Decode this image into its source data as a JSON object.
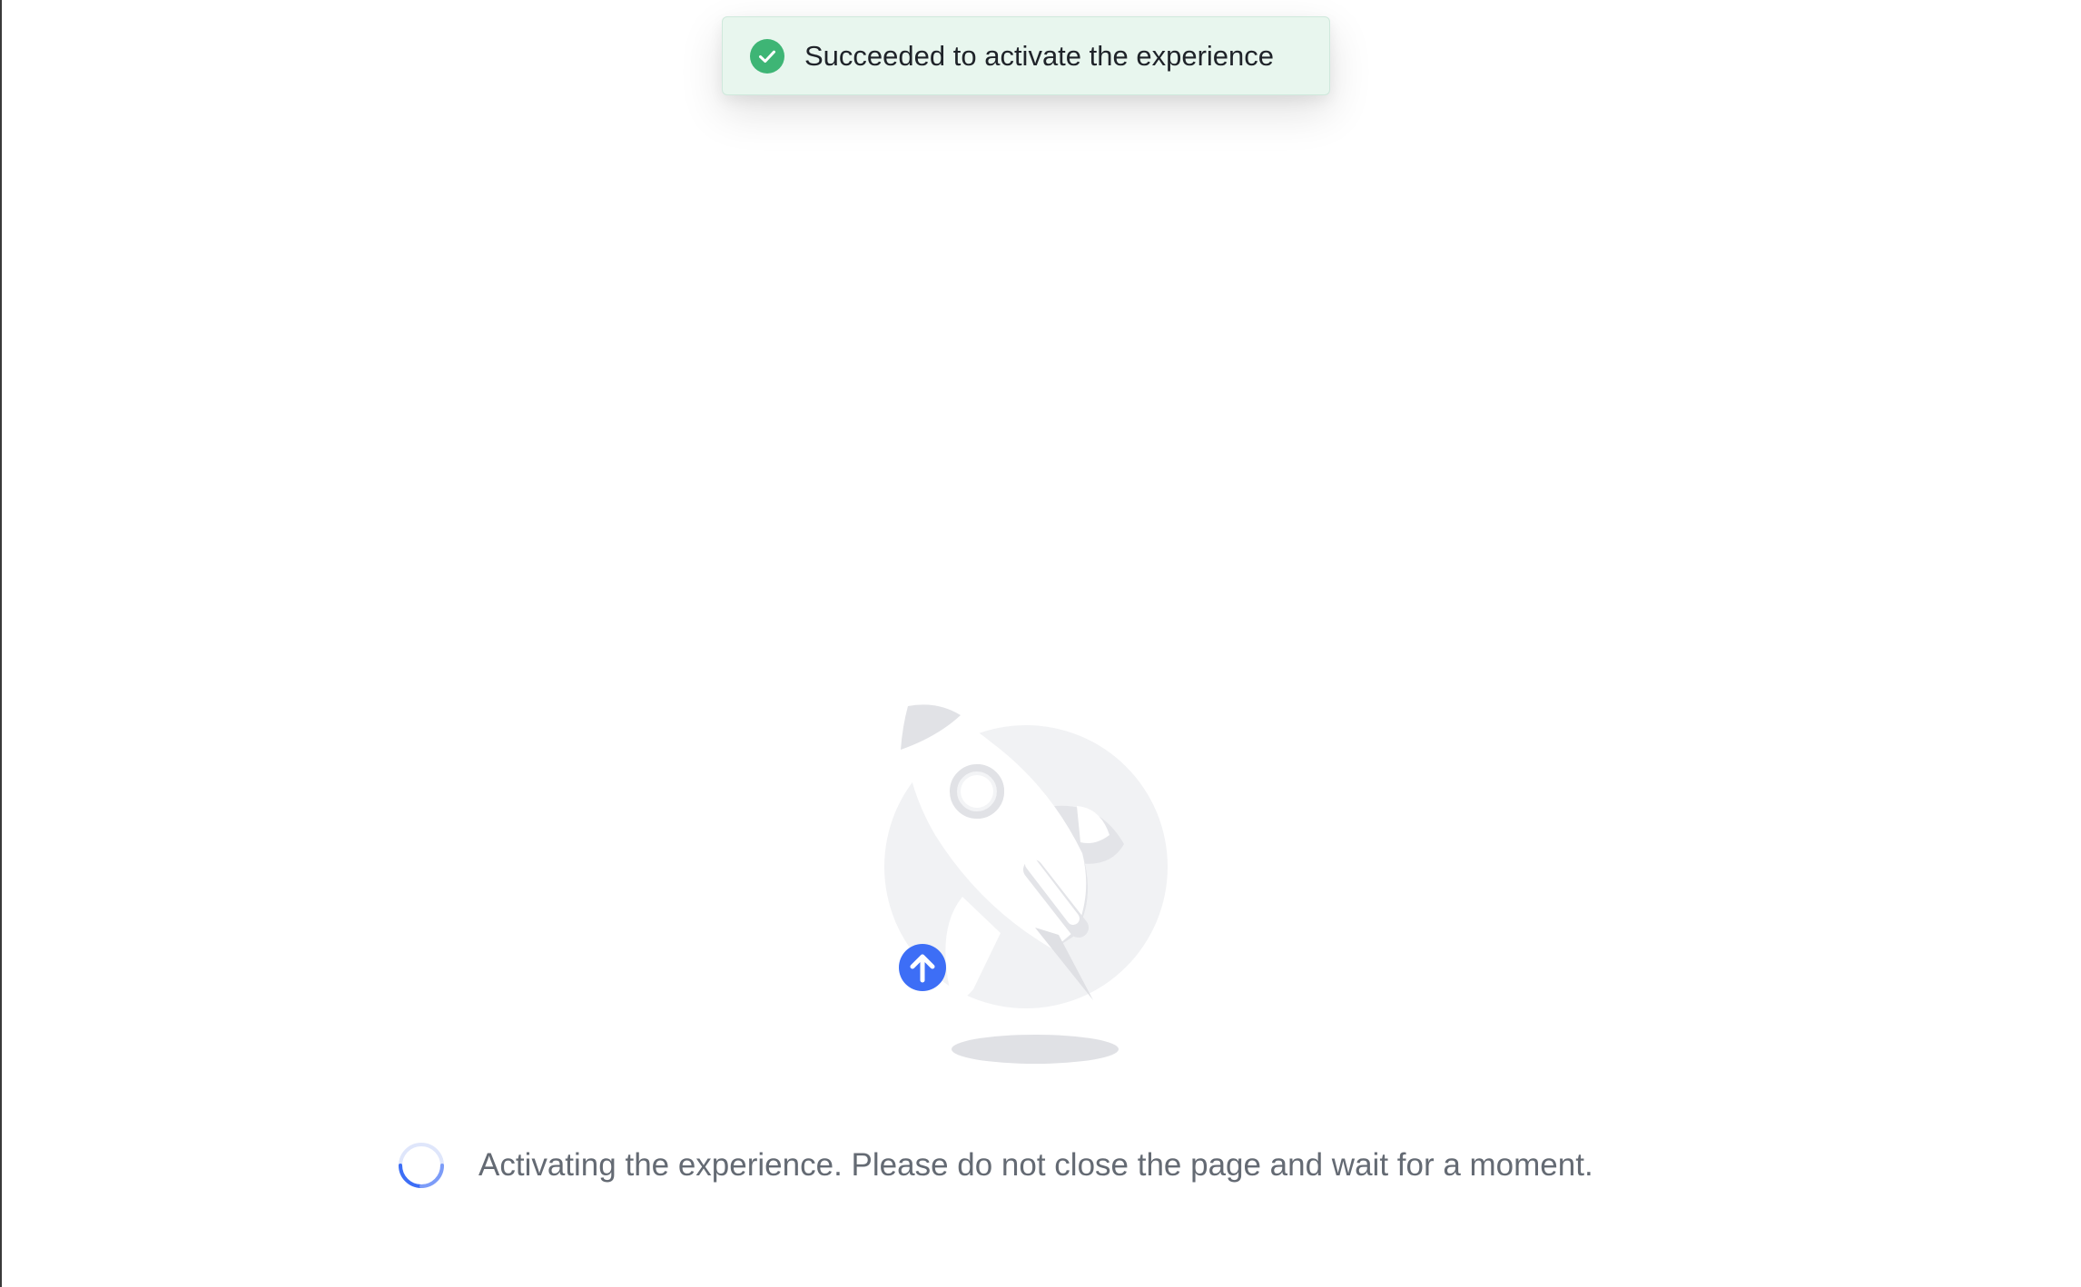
{
  "toast": {
    "message": "Succeeded to activate the experience",
    "icon": "check-circle-icon",
    "status_color": "#3eb575"
  },
  "illustration": {
    "icon": "rocket-illustration",
    "badge_icon": "upload-arrow-icon",
    "accent_color": "#3d6ef6"
  },
  "status": {
    "message": "Activating the experience. Please do not close the page and wait for a moment.",
    "icon": "loading-spinner-icon",
    "spinner_color": "#3d6ef6"
  }
}
